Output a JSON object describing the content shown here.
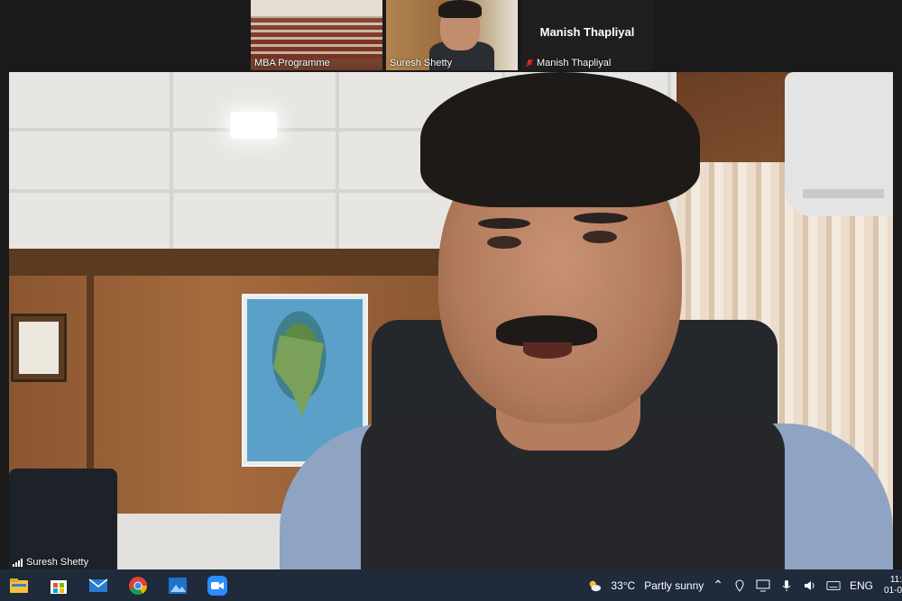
{
  "thumbnails": [
    {
      "name": "MBA Programme"
    },
    {
      "name": "Suresh Shetty"
    },
    {
      "name": "Manish Thapliyal",
      "display_name": "Manish Thapliyal",
      "muted": true
    }
  ],
  "main_video": {
    "speaker": "Suresh Shetty"
  },
  "taskbar": {
    "apps": [
      "file-explorer",
      "store",
      "mail",
      "chrome",
      "photos",
      "zoom"
    ],
    "weather_temp": "33°C",
    "weather_desc": "Partly sunny",
    "language": "ENG",
    "time": "11:",
    "date": "01-0"
  },
  "colors": {
    "taskbar_bg": "#1f2a3a",
    "zoom_blue": "#2d8cff",
    "mute_red": "#e02828"
  }
}
